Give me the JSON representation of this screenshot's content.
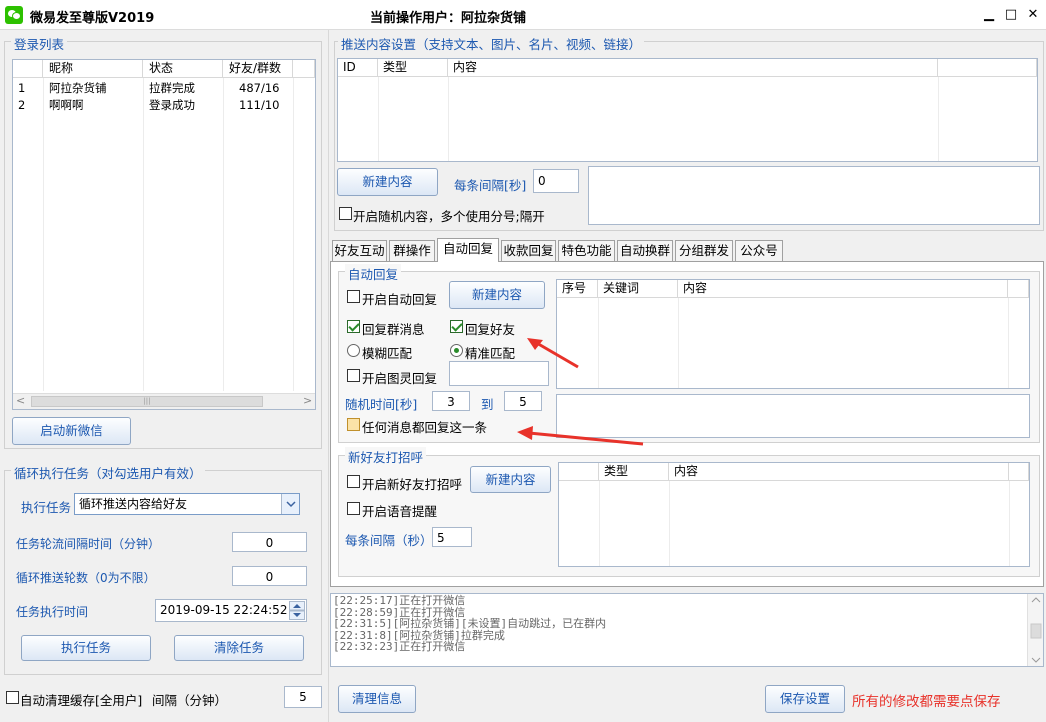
{
  "window": {
    "title": "微易发至尊版V2019",
    "user_label": "当前操作用户：阿拉杂货铺",
    "min": "▁",
    "max": "□",
    "close": "✕"
  },
  "login": {
    "group_label": "登录列表",
    "columns": [
      "",
      "昵称",
      "状态",
      "好友/群数"
    ],
    "rows": [
      {
        "idx": "1",
        "nick": "阿拉杂货铺",
        "status": "拉群完成",
        "count": "487/16"
      },
      {
        "idx": "2",
        "nick": "啊啊啊",
        "status": "登录成功",
        "count": "111/10"
      }
    ],
    "start_button": "启动新微信",
    "scroll_left": "<",
    "scroll_right": ">",
    "scroll_grip": "|||"
  },
  "loop": {
    "group_label": "循环执行任务（对勾选用户有效）",
    "task_label": "执行任务",
    "task_value": "循环推送内容给好友",
    "interval_label": "任务轮流间隔时间（分钟）",
    "interval_value": "0",
    "rounds_label": "循环推送轮数（0为不限）",
    "rounds_value": "0",
    "time_label": "任务执行时间",
    "time_value": "2019-09-15 22:24:52",
    "exec_button": "执行任务",
    "clear_button": "清除任务"
  },
  "cache": {
    "label": "自动清理缓存[全用户]",
    "interval_label": "间隔（分钟）",
    "interval_value": "5"
  },
  "push": {
    "group_label": "推送内容设置（支持文本、图片、名片、视频、链接）",
    "columns": [
      "ID",
      "类型",
      "内容"
    ],
    "new_button": "新建内容",
    "interval_label": "每条间隔[秒]",
    "interval_value": "0",
    "random_label": "开启随机内容，多个使用分号;隔开"
  },
  "tabs": [
    "好友互动",
    "群操作",
    "自动回复",
    "收款回复",
    "特色功能",
    "自动换群",
    "分组群发",
    "公众号"
  ],
  "auto_reply": {
    "group_label": "自动回复",
    "enable_label": "开启自动回复",
    "new_button": "新建内容",
    "reply_group_label": "回复群消息",
    "reply_friend_label": "回复好友",
    "fuzzy_label": "模糊匹配",
    "exact_label": "精准匹配",
    "tuling_label": "开启图灵回复",
    "random_label": "随机时间[秒]",
    "random_from": "3",
    "to_label": "到",
    "random_to": "5",
    "any_label": "任何消息都回复这一条",
    "columns": [
      "序号",
      "关键词",
      "内容"
    ]
  },
  "greet": {
    "group_label": "新好友打招呼",
    "enable_label": "开启新好友打招呼",
    "new_button": "新建内容",
    "voice_label": "开启语音提醒",
    "interval_label": "每条间隔（秒）",
    "interval_value": "5",
    "columns": [
      "类型",
      "内容"
    ]
  },
  "log": {
    "lines": [
      "[22:25:17]正在打开微信",
      "[22:28:59]正在打开微信",
      "[22:31:5][阿拉杂货铺][未设置]自动跳过，已在群内",
      "[22:31:8][阿拉杂货铺]拉群完成",
      "[22:32:23]正在打开微信"
    ]
  },
  "footer": {
    "clear_button": "清理信息",
    "save_button": "保存设置",
    "save_hint": "所有的修改都需要点保存"
  },
  "colors": {
    "accent": "#1c58b0",
    "warn": "#e8322a",
    "check": "#2a8b2a"
  }
}
